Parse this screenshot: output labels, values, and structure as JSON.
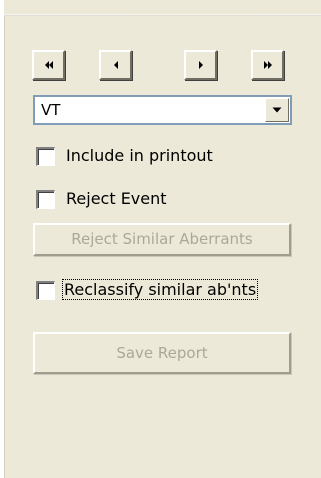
{
  "nav": {
    "first_icon": "double-left-arrow",
    "prev_icon": "left-arrow",
    "next_icon": "right-arrow",
    "last_icon": "double-right-arrow"
  },
  "rhythm_select": {
    "value": "VT",
    "icon": "chevron-down"
  },
  "include_printout": {
    "label": "Include in printout",
    "checked": false
  },
  "reject_event": {
    "label": "Reject Event",
    "checked": false
  },
  "reject_similar": {
    "label": "Reject Similar Aberrants",
    "enabled": false
  },
  "reclassify": {
    "label": "Reclassify similar ab'nts",
    "checked": false
  },
  "save_report": {
    "label": "Save Report",
    "enabled": false
  },
  "colors": {
    "panel": "#ece9d8",
    "disabled_text": "#aca899",
    "combo_border": "#7f9db9"
  }
}
